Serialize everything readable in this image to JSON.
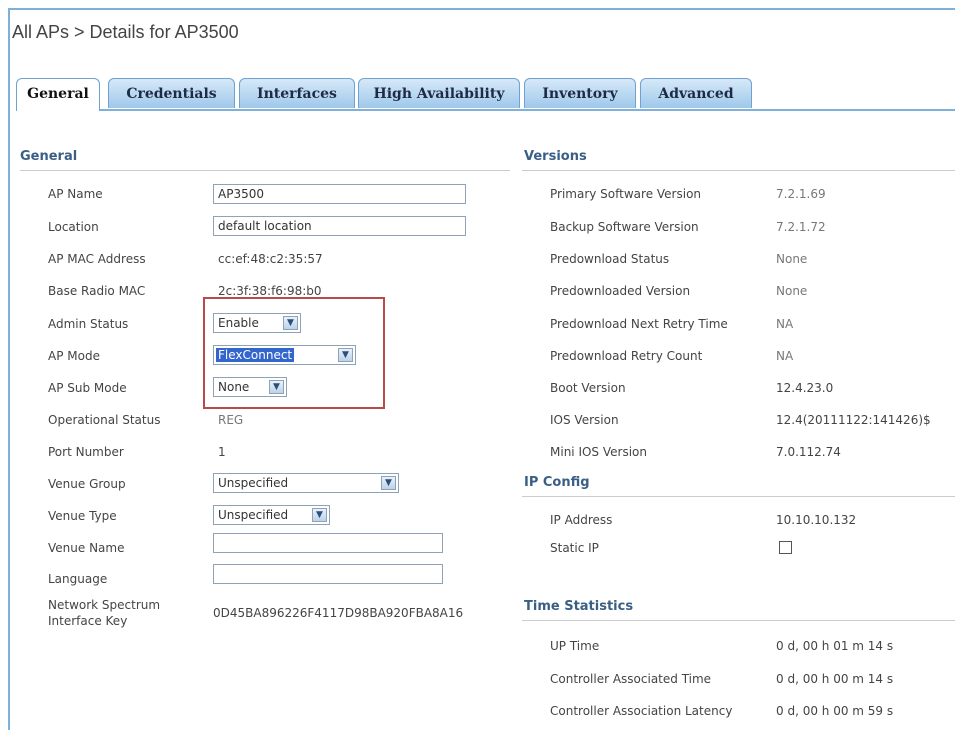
{
  "breadcrumb": "All APs > Details for AP3500",
  "tabs": [
    {
      "label": "General",
      "active": true
    },
    {
      "label": "Credentials",
      "active": false
    },
    {
      "label": "Interfaces",
      "active": false
    },
    {
      "label": "High Availability",
      "active": false
    },
    {
      "label": "Inventory",
      "active": false
    },
    {
      "label": "Advanced",
      "active": false
    }
  ],
  "general": {
    "title": "General",
    "ap_name": {
      "label": "AP Name",
      "value": "AP3500"
    },
    "location": {
      "label": "Location",
      "value": "default location"
    },
    "ap_mac": {
      "label": "AP MAC Address",
      "value": "cc:ef:48:c2:35:57"
    },
    "base_radio_mac": {
      "label": "Base Radio MAC",
      "value": "2c:3f:38:f6:98:b0"
    },
    "admin_status": {
      "label": "Admin Status",
      "value": "Enable"
    },
    "ap_mode": {
      "label": "AP Mode",
      "value": "FlexConnect"
    },
    "ap_sub_mode": {
      "label": "AP Sub Mode",
      "value": "None"
    },
    "operational_status": {
      "label": "Operational Status",
      "value": "REG"
    },
    "port_number": {
      "label": "Port Number",
      "value": "1"
    },
    "venue_group": {
      "label": "Venue Group",
      "value": "Unspecified"
    },
    "venue_type": {
      "label": "Venue Type",
      "value": "Unspecified"
    },
    "venue_name": {
      "label": "Venue Name",
      "value": ""
    },
    "language": {
      "label": "Language",
      "value": ""
    },
    "nsi_key": {
      "label_line1": "Network Spectrum",
      "label_line2": "Interface Key",
      "value": "0D45BA896226F4117D98BA920FBA8A16"
    }
  },
  "versions": {
    "title": "Versions",
    "rows": [
      {
        "label": "Primary Software Version",
        "value": "7.2.1.69"
      },
      {
        "label": "Backup Software Version",
        "value": "7.2.1.72"
      },
      {
        "label": "Predownload Status",
        "value": "None"
      },
      {
        "label": "Predownloaded Version",
        "value": "None"
      },
      {
        "label": "Predownload Next Retry Time",
        "value": "NA"
      },
      {
        "label": "Predownload Retry Count",
        "value": "NA"
      },
      {
        "label": "Boot Version",
        "value": "12.4.23.0"
      },
      {
        "label": "IOS Version",
        "value": "12.4(20111122:141426)$"
      },
      {
        "label": "Mini IOS Version",
        "value": "7.0.112.74"
      }
    ]
  },
  "ip_config": {
    "title": "IP Config",
    "ip_address": {
      "label": "IP Address",
      "value": "10.10.10.132"
    },
    "static_ip": {
      "label": "Static IP",
      "checked": false
    }
  },
  "time_statistics": {
    "title": "Time Statistics",
    "rows": [
      {
        "label": "UP Time",
        "value": "0 d, 00 h 01 m 14 s"
      },
      {
        "label": "Controller Associated Time",
        "value": "0 d, 00 h 00 m 14 s"
      },
      {
        "label": "Controller Association Latency",
        "value": "0 d, 00 h 00 m 59 s"
      }
    ]
  },
  "colors": {
    "tab_border": "#6fa2cf",
    "section_title": "#3a5f86",
    "highlight_box": "#b74b4b"
  }
}
